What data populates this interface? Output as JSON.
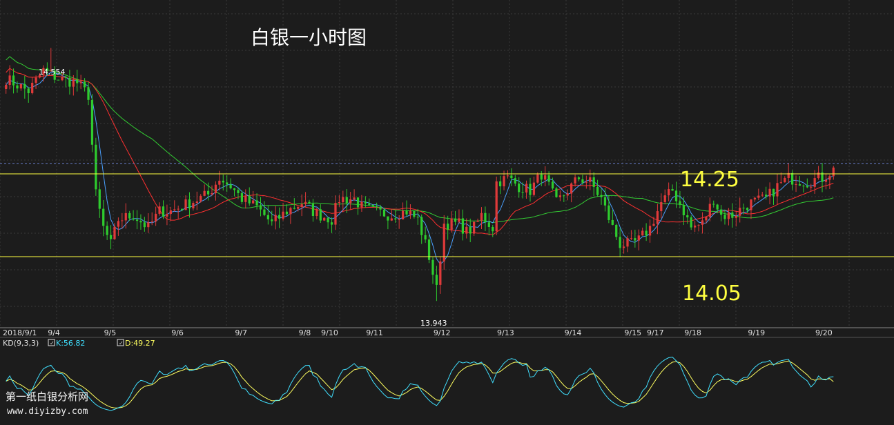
{
  "title": "白银一小时图",
  "watermark": {
    "line1": "第一纸白银分析网",
    "line2": "www.diyizby.com"
  },
  "colors": {
    "background": "#1c1c1c",
    "grid": "#3a3a3a",
    "up_candle": "#e03a3a",
    "down_candle": "#2ecc2e",
    "ma_fast": "#4aa0ff",
    "ma_mid": "#ff3030",
    "ma_slow": "#33cc33",
    "level_lines": "#ffff40",
    "dashed_line": "#6a7fd0",
    "kd_k": "#40e0ff",
    "kd_d": "#ffff60",
    "axis_text": "#e0e0e0"
  },
  "chart_data": {
    "type": "candlestick",
    "title": "白银一小时图",
    "ylim": [
      13.88,
      14.67
    ],
    "x_tick_labels": [
      "2018/9/1",
      "9/4",
      "9/5",
      "9/6",
      "9/7",
      "9/8",
      "9/10",
      "9/11",
      "9/12",
      "9/13",
      "9/14",
      "9/15",
      "9/17",
      "9/18",
      "9/19",
      "9/20"
    ],
    "x_tick_positions": [
      0,
      13,
      28,
      46,
      63,
      80,
      86,
      98,
      116,
      133,
      151,
      167,
      173,
      183,
      200,
      218
    ],
    "candle_count": 222,
    "annotations": [
      {
        "label": "14.554",
        "index": 12,
        "value": 14.554,
        "kind": "high"
      },
      {
        "label": "13.943",
        "index": 115,
        "value": 13.943,
        "kind": "low"
      }
    ],
    "levels": [
      {
        "label": "14.25",
        "value": 14.25
      },
      {
        "label": "14.05",
        "value": 14.05
      }
    ],
    "dashed_level": 14.275,
    "price_anchors": [
      [
        0,
        14.48
      ],
      [
        6,
        14.45
      ],
      [
        10,
        14.5
      ],
      [
        14,
        14.48
      ],
      [
        19,
        14.47
      ],
      [
        22,
        14.44
      ],
      [
        24,
        14.2
      ],
      [
        26,
        14.12
      ],
      [
        28,
        14.08
      ],
      [
        30,
        14.14
      ],
      [
        34,
        14.15
      ],
      [
        38,
        14.12
      ],
      [
        41,
        14.16
      ],
      [
        44,
        14.16
      ],
      [
        49,
        14.18
      ],
      [
        54,
        14.2
      ],
      [
        57,
        14.24
      ],
      [
        60,
        14.22
      ],
      [
        63,
        14.19
      ],
      [
        67,
        14.17
      ],
      [
        71,
        14.13
      ],
      [
        75,
        14.16
      ],
      [
        79,
        14.18
      ],
      [
        82,
        14.16
      ],
      [
        84,
        14.15
      ],
      [
        87,
        14.14
      ],
      [
        89,
        14.19
      ],
      [
        93,
        14.19
      ],
      [
        95,
        14.17
      ],
      [
        98,
        14.16
      ],
      [
        103,
        14.15
      ],
      [
        107,
        14.16
      ],
      [
        110,
        14.14
      ],
      [
        113,
        14.05
      ],
      [
        115,
        13.97
      ],
      [
        117,
        14.13
      ],
      [
        121,
        14.13
      ],
      [
        123,
        14.11
      ],
      [
        125,
        14.12
      ],
      [
        127,
        14.15
      ],
      [
        130,
        14.12
      ],
      [
        131,
        14.23
      ],
      [
        134,
        14.24
      ],
      [
        137,
        14.22
      ],
      [
        140,
        14.21
      ],
      [
        143,
        14.25
      ],
      [
        145,
        14.22
      ],
      [
        147,
        14.18
      ],
      [
        150,
        14.21
      ],
      [
        153,
        14.24
      ],
      [
        156,
        14.23
      ],
      [
        159,
        14.19
      ],
      [
        162,
        14.12
      ],
      [
        164,
        14.08
      ],
      [
        167,
        14.08
      ],
      [
        169,
        14.09
      ],
      [
        172,
        14.12
      ],
      [
        175,
        14.18
      ],
      [
        178,
        14.21
      ],
      [
        181,
        14.16
      ],
      [
        183,
        14.12
      ],
      [
        186,
        14.13
      ],
      [
        189,
        14.19
      ],
      [
        191,
        14.15
      ],
      [
        194,
        14.15
      ],
      [
        197,
        14.17
      ],
      [
        199,
        14.18
      ],
      [
        203,
        14.19
      ],
      [
        206,
        14.22
      ],
      [
        209,
        14.24
      ],
      [
        214,
        14.23
      ],
      [
        217,
        14.24
      ],
      [
        218,
        14.24
      ],
      [
        221,
        14.26
      ]
    ],
    "indicator": {
      "name": "KD(9,3,3)",
      "k_label": "K:56.82",
      "d_label": "D:49.27",
      "k": 56.82,
      "d": 49.27,
      "ylim": [
        0,
        100
      ]
    }
  }
}
